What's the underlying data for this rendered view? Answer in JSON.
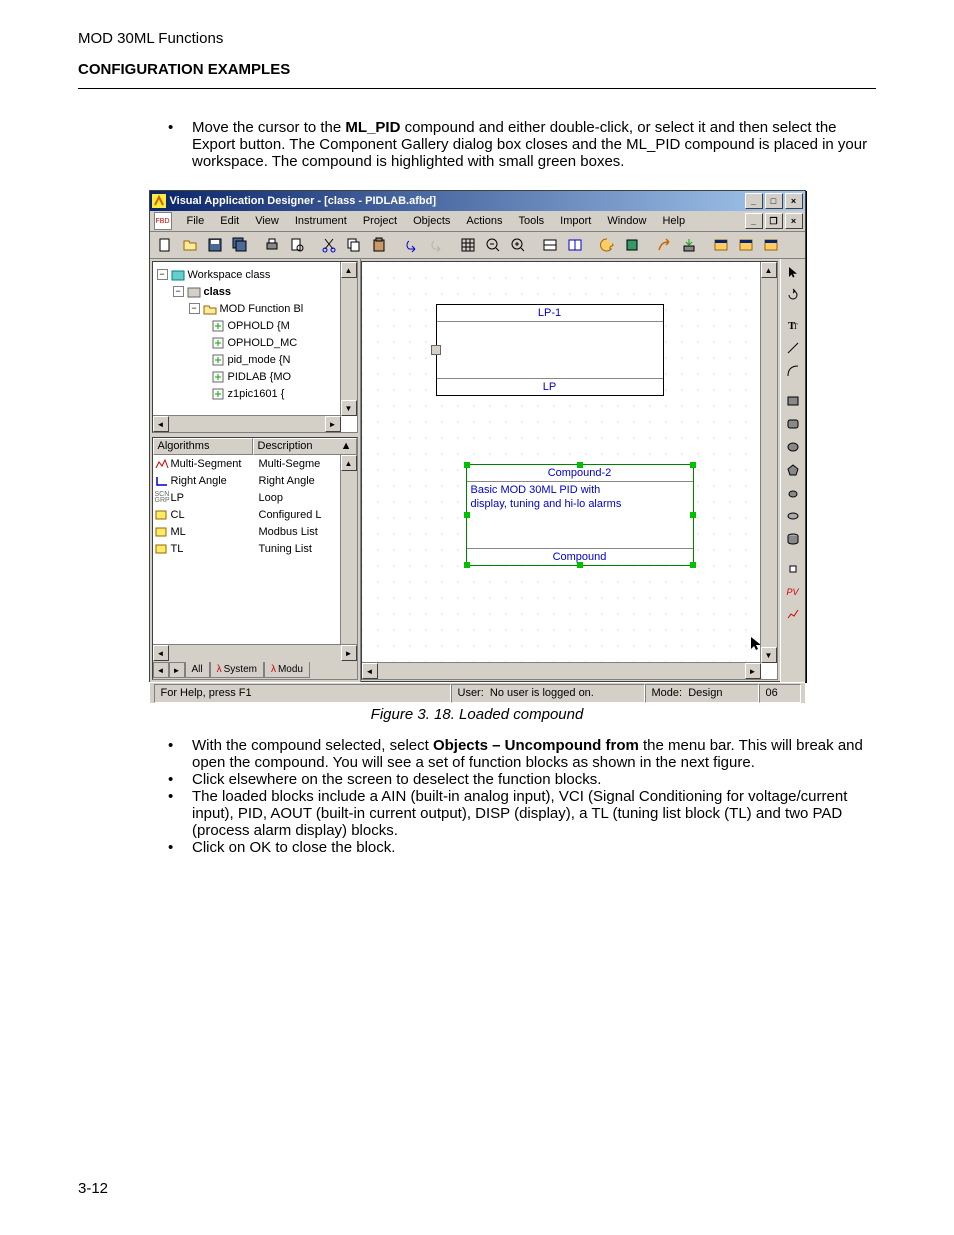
{
  "doc": {
    "header_top": "MOD 30ML Functions",
    "header_title": "CONFIGURATION EXAMPLES",
    "bullet1_a": "Move the cursor to the ",
    "bullet1_b": "ML_PID",
    "bullet1_c": " compound and either double-click, or select it and then select the Export button.  The Component Gallery dialog box closes and the ML_PID compound is placed in your workspace.  The compound is highlighted with small green boxes.",
    "fig_caption": "Figure 3. 18. Loaded compound",
    "bullet2_a": "With the compound selected, select ",
    "bullet2_b": "Objects – Uncompound from",
    "bullet2_c": " the menu bar. This will break and open the compound. You will see a set of function blocks as shown in the next figure.",
    "bullet3": "Click elsewhere on the screen to deselect the function blocks.",
    "bullet4": "The loaded blocks include a AIN (built-in analog input), VCI (Signal Conditioning for voltage/current input), PID, AOUT (built-in current output), DISP (display), a TL (tuning list block (TL) and two PAD (process alarm display) blocks.",
    "bullet5": "Click on OK to close the block.",
    "page_num": "3-12"
  },
  "app": {
    "title": "Visual Application Designer - [class - PIDLAB.afbd]",
    "menu": [
      "File",
      "Edit",
      "View",
      "Instrument",
      "Project",
      "Objects",
      "Actions",
      "Tools",
      "Import",
      "Window",
      "Help"
    ],
    "tree": {
      "root": "Workspace class",
      "l1": "class",
      "l2": "MOD Function Bl",
      "items": [
        "OPHOLD {M",
        "OPHOLD_MC",
        "pid_mode {N",
        "PIDLAB {MO",
        "z1pic1601 {"
      ]
    },
    "grid": {
      "hdr1": "Algorithms",
      "hdr2": "Description",
      "rows": [
        {
          "n": "Multi-Segment",
          "d": "Multi-Segme",
          "icon": "seg"
        },
        {
          "n": "Right Angle",
          "d": "Right Angle",
          "icon": "ra"
        },
        {
          "n": "LP",
          "d": "Loop",
          "icon": "lp"
        },
        {
          "n": "CL",
          "d": "Configured L",
          "icon": "cl"
        },
        {
          "n": "ML",
          "d": "Modbus List",
          "icon": "ml"
        },
        {
          "n": "TL",
          "d": "Tuning List",
          "icon": "tl"
        }
      ],
      "tabs": [
        "All",
        "System",
        "Modu"
      ]
    },
    "canvas": {
      "lp1": "LP-1",
      "lp": "LP",
      "compound2": "Compound-2",
      "compound2_desc1": "Basic MOD 30ML  PID with",
      "compound2_desc2": "display, tuning and hi-lo alarms",
      "compound": "Compound"
    },
    "status": {
      "help": "For Help, press F1",
      "user_l": "User:",
      "user_v": "No user is logged on.",
      "mode_l": "Mode:",
      "mode_v": "Design",
      "num": "06"
    }
  }
}
